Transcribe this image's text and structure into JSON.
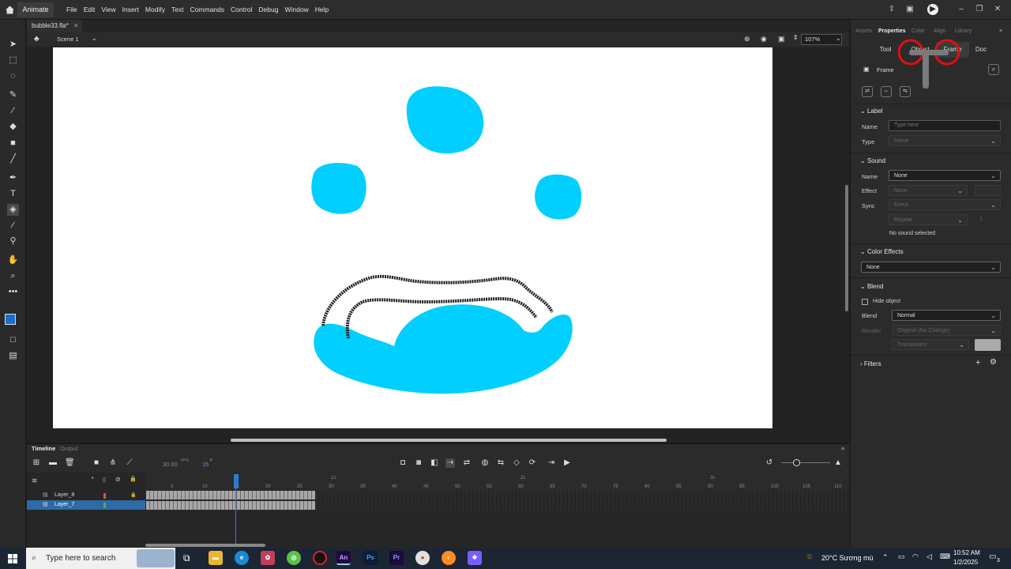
{
  "app": {
    "name": "Animate",
    "menus": [
      "File",
      "Edit",
      "View",
      "Insert",
      "Modify",
      "Text",
      "Commands",
      "Control",
      "Debug",
      "Window",
      "Help"
    ]
  },
  "document": {
    "tab_title": "bubble33.fla*",
    "scene": "Scene 1",
    "zoom": "107%"
  },
  "timeline": {
    "tabs": [
      "Timeline",
      "Output"
    ],
    "fps": "30.00",
    "fps_unit": "FPS",
    "current_frame": "15",
    "frame_unit": "F",
    "ruler_ticks": [
      "5",
      "10",
      "15",
      "20",
      "25",
      "30",
      "35",
      "40",
      "45",
      "50",
      "55",
      "60",
      "65",
      "70",
      "75",
      "80",
      "85",
      "90",
      "95",
      "100",
      "105",
      "110"
    ],
    "second_markers": [
      "1s",
      "2s",
      "3s"
    ],
    "layers": [
      {
        "name": "Layer_8",
        "color": "#e05050",
        "locked": true,
        "selected": false
      },
      {
        "name": "Layer_7",
        "color": "#4caf50",
        "locked": false,
        "selected": true
      }
    ]
  },
  "properties_panel": {
    "top_tabs": [
      "Assets",
      "Properties",
      "Color",
      "Align",
      "Library"
    ],
    "active_top_tab": "Properties",
    "sub_tabs": [
      "Tool",
      "Object",
      "Frame",
      "Doc"
    ],
    "active_sub_tab": "Frame",
    "header": "Frame",
    "label_section": {
      "title": "Label",
      "name_label": "Name",
      "name_placeholder": "Type here",
      "type_label": "Type",
      "type_value": "Name"
    },
    "sound_section": {
      "title": "Sound",
      "name_label": "Name",
      "name_value": "None",
      "effect_label": "Effect",
      "effect_value": "None",
      "sync_label": "Sync",
      "sync_value": "Event",
      "repeat_value": "Repeat",
      "repeat_count": "1",
      "status": "No sound selected"
    },
    "color_effects": {
      "title": "Color Effects",
      "value": "None"
    },
    "blend_section": {
      "title": "Blend",
      "hide_object_label": "Hide object",
      "blend_label": "Blend",
      "blend_value": "Normal",
      "render_label": "Render",
      "render_value": "Original (No Change)",
      "transparent_value": "Transparent"
    },
    "filters": {
      "title": "Filters"
    }
  },
  "taskbar": {
    "search_placeholder": "Type here to search",
    "weather": "20°C  Sương mù",
    "time": "10:52 AM",
    "date": "1/2/2025",
    "notif_count": "3",
    "apps": [
      "An",
      "Ps",
      "Pr"
    ]
  },
  "colors": {
    "bubble": "#00cfff",
    "selection": "#2d6aa6",
    "annotation_circle": "#e01010"
  }
}
